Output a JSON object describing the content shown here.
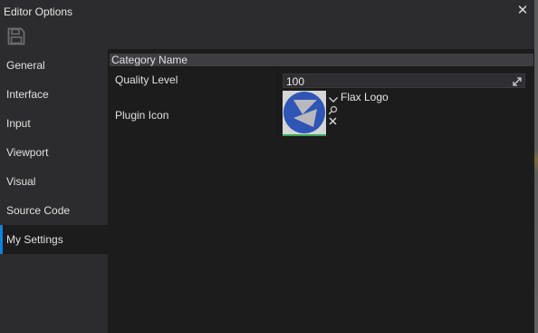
{
  "window": {
    "title": "Editor Options",
    "close_glyph": "✕"
  },
  "toolbar": {
    "save_icon": "save-icon"
  },
  "sidebar": {
    "items": [
      {
        "label": "General"
      },
      {
        "label": "Interface"
      },
      {
        "label": "Input"
      },
      {
        "label": "Viewport"
      },
      {
        "label": "Visual"
      },
      {
        "label": "Source Code"
      },
      {
        "label": "My Settings"
      }
    ],
    "active_index": 6
  },
  "main": {
    "category": "Category Name",
    "quality_level": {
      "label": "Quality Level",
      "value": "100"
    },
    "plugin_icon": {
      "label": "Plugin Icon",
      "asset_name": "Flax Logo"
    }
  },
  "colors": {
    "accent": "#0f83d9",
    "asset_valid": "#3aa84f",
    "logo_blue": "#2f55b6"
  }
}
